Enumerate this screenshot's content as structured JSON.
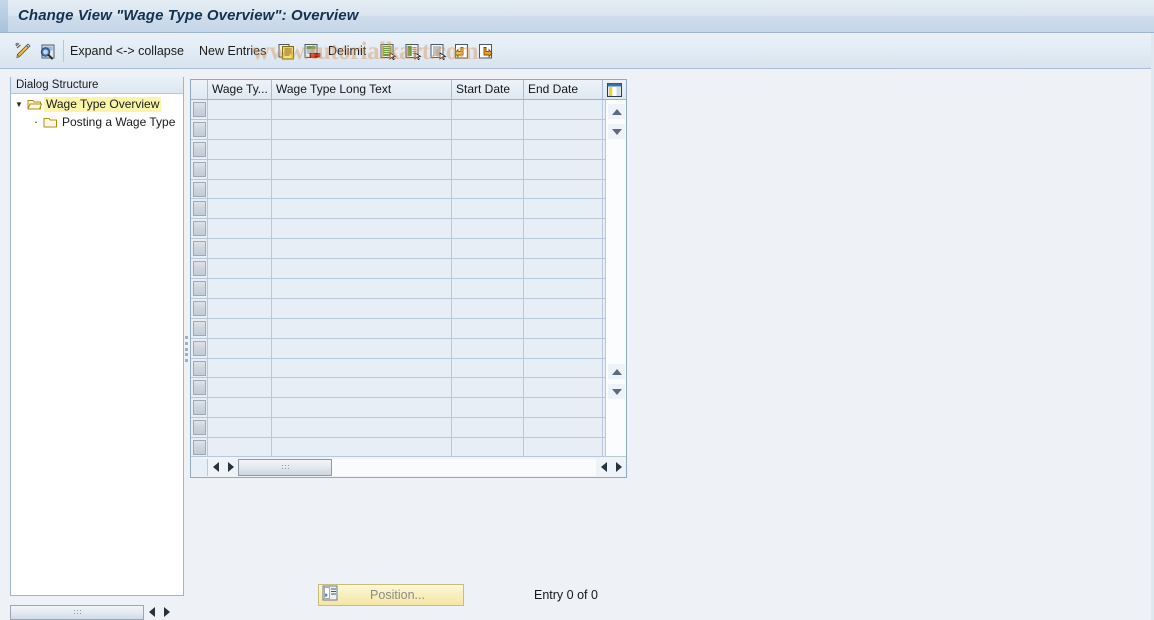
{
  "window": {
    "title": "Change View \"Wage Type Overview\": Overview"
  },
  "toolbar": {
    "edit_icon": "pencil-edit-icon",
    "display_icon": "magnifier-display-icon",
    "expand_collapse_label": "Expand <-> collapse",
    "new_entries_label": "New Entries",
    "copy_icon": "copy-as-icon",
    "delete_icon": "delete-icon",
    "delimit_label": "Delimit",
    "select_all_icon": "select-all-icon",
    "select_block_icon": "select-block-icon",
    "deselect_all_icon": "deselect-all-icon",
    "previous_icon": "previous-entry-icon",
    "next_icon": "next-entry-icon"
  },
  "watermark": {
    "text": "www.tutorialkart.com"
  },
  "sidebar": {
    "header": "Dialog Structure",
    "items": [
      {
        "label": "Wage Type Overview",
        "icon": "open-folder-icon",
        "selected": true,
        "level": 0,
        "expanded": true
      },
      {
        "label": "Posting a Wage Type",
        "icon": "folder-icon",
        "selected": false,
        "level": 1,
        "expanded": false
      }
    ],
    "hscroll_grip": "scrollbar-grip"
  },
  "table": {
    "columns": [
      {
        "key": "wage_type",
        "label": "Wage Ty..."
      },
      {
        "key": "long_text",
        "label": "Wage Type Long Text"
      },
      {
        "key": "start_date",
        "label": "Start Date"
      },
      {
        "key": "end_date",
        "label": "End Date"
      }
    ],
    "config_icon": "column-settings-icon",
    "rows": [],
    "empty_row_count": 18,
    "vscroll": {
      "up_icon": "scroll-up-icon",
      "down_icon": "scroll-down-icon"
    },
    "hscroll": {
      "left_icon": "scroll-left-icon",
      "right_icon": "scroll-right-icon",
      "grip": "scrollbar-grip"
    }
  },
  "footer": {
    "position_button_label": "Position...",
    "position_button_icon": "position-icon",
    "entry_count": "Entry 0 of 0"
  },
  "colors": {
    "title_text": "#14314f",
    "selection_highlight": "#fbf5a8",
    "grid_background": "#e8eef6",
    "grid_line": "#b9c8d8",
    "panel_border": "#9fb6cc",
    "button_yellow": "#f8eeba",
    "watermark": "#d7965a"
  }
}
